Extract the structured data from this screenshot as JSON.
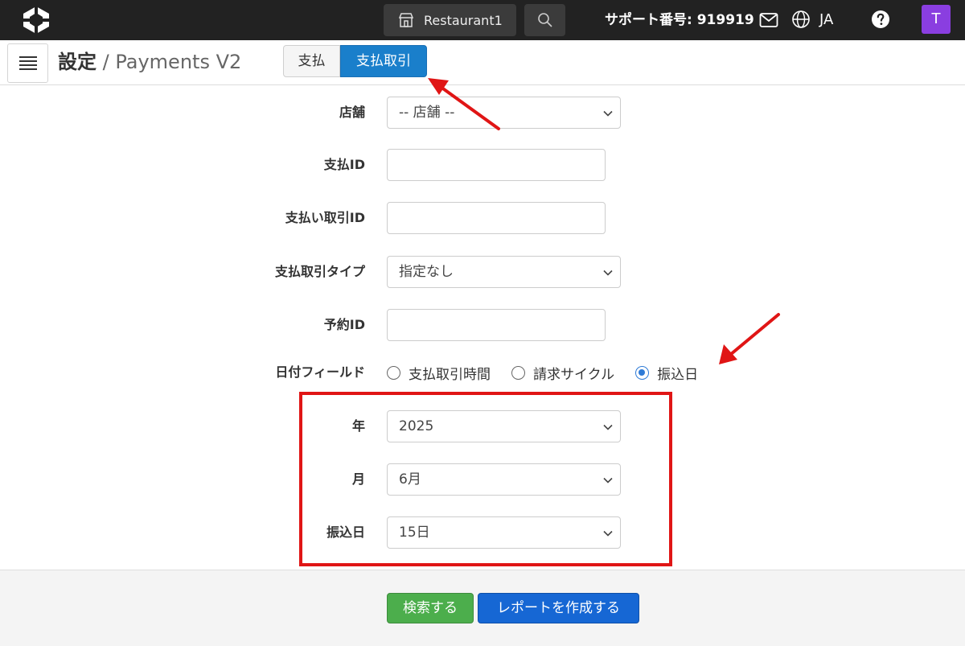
{
  "topbar": {
    "store_label": "Restaurant1",
    "support_text": "サポート番号: 919919",
    "language": "JA",
    "avatar_initial": "T"
  },
  "header": {
    "title_strong": "設定",
    "title_separator": "/",
    "title_sub": "Payments V2",
    "tabs": [
      {
        "label": "支払",
        "active": false
      },
      {
        "label": "支払取引",
        "active": true
      }
    ]
  },
  "form": {
    "store": {
      "label": "店舗",
      "value": "-- 店舗 --"
    },
    "payment_id": {
      "label": "支払ID",
      "value": ""
    },
    "payment_transaction_id": {
      "label": "支払い取引ID",
      "value": ""
    },
    "transaction_type": {
      "label": "支払取引タイプ",
      "value": "指定なし"
    },
    "reservation_id": {
      "label": "予約ID",
      "value": ""
    },
    "date_field": {
      "label": "日付フィールド",
      "options": [
        {
          "label": "支払取引時間",
          "checked": false
        },
        {
          "label": "請求サイクル",
          "checked": false
        },
        {
          "label": "振込日",
          "checked": true
        }
      ]
    },
    "year": {
      "label": "年",
      "value": "2025"
    },
    "month": {
      "label": "月",
      "value": "6月"
    },
    "transfer_day": {
      "label": "振込日",
      "value": "15日"
    }
  },
  "footer": {
    "search_label": "検索する",
    "report_label": "レポートを作成する"
  },
  "colors": {
    "topbar": "#222222",
    "active_tab": "#1a7fcb",
    "search_button": "#4cae4c",
    "report_button": "#1667d4",
    "annotation": "#e01515",
    "avatar": "#8a3ee0"
  }
}
